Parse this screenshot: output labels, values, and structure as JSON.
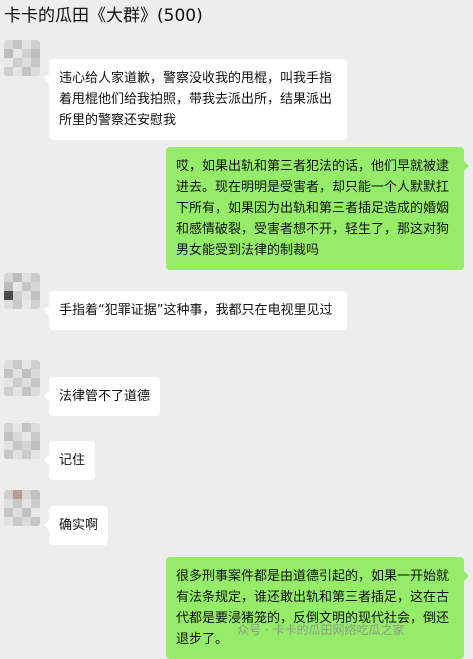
{
  "header": {
    "title": "卡卡的瓜田《大群》(500)"
  },
  "messages": [
    {
      "side": "left",
      "text": "违心给人家道歉，警察没收我的甩棍，叫我手指着甩棍他们给我拍照，带我去派出所，结果派出所里的警察还安慰我"
    },
    {
      "side": "right",
      "text": "哎，如果出轨和第三者犯法的话，他们早就被逮进去。现在明明是受害者，却只能一个人默默扛下所有，如果因为出轨和第三者插足造成的婚姻和感情破裂，受害者想不开，轻生了，那这对狗男女能受到法律的制裁吗"
    },
    {
      "side": "left",
      "text": "手指着“犯罪证据”这种事，我都只在电视里见过"
    },
    {
      "side": "left",
      "text": "法律管不了道德"
    },
    {
      "side": "left",
      "text": "记住"
    },
    {
      "side": "left",
      "text": "确实啊"
    },
    {
      "side": "right",
      "text": "很多刑事案件都是由道德引起的，如果一开始就有法条规定，谁还敢出轨和第三者插足，这在古代都是要浸猪笼的，反倒文明的现代社会，倒还退步了。"
    }
  ],
  "watermark": {
    "text": "众号 · 卡卡的瓜田网络吃瓜之家"
  },
  "colors": {
    "background": "#ededed",
    "left_bubble": "#ffffff",
    "right_bubble": "#95ec69",
    "text": "#111111"
  }
}
